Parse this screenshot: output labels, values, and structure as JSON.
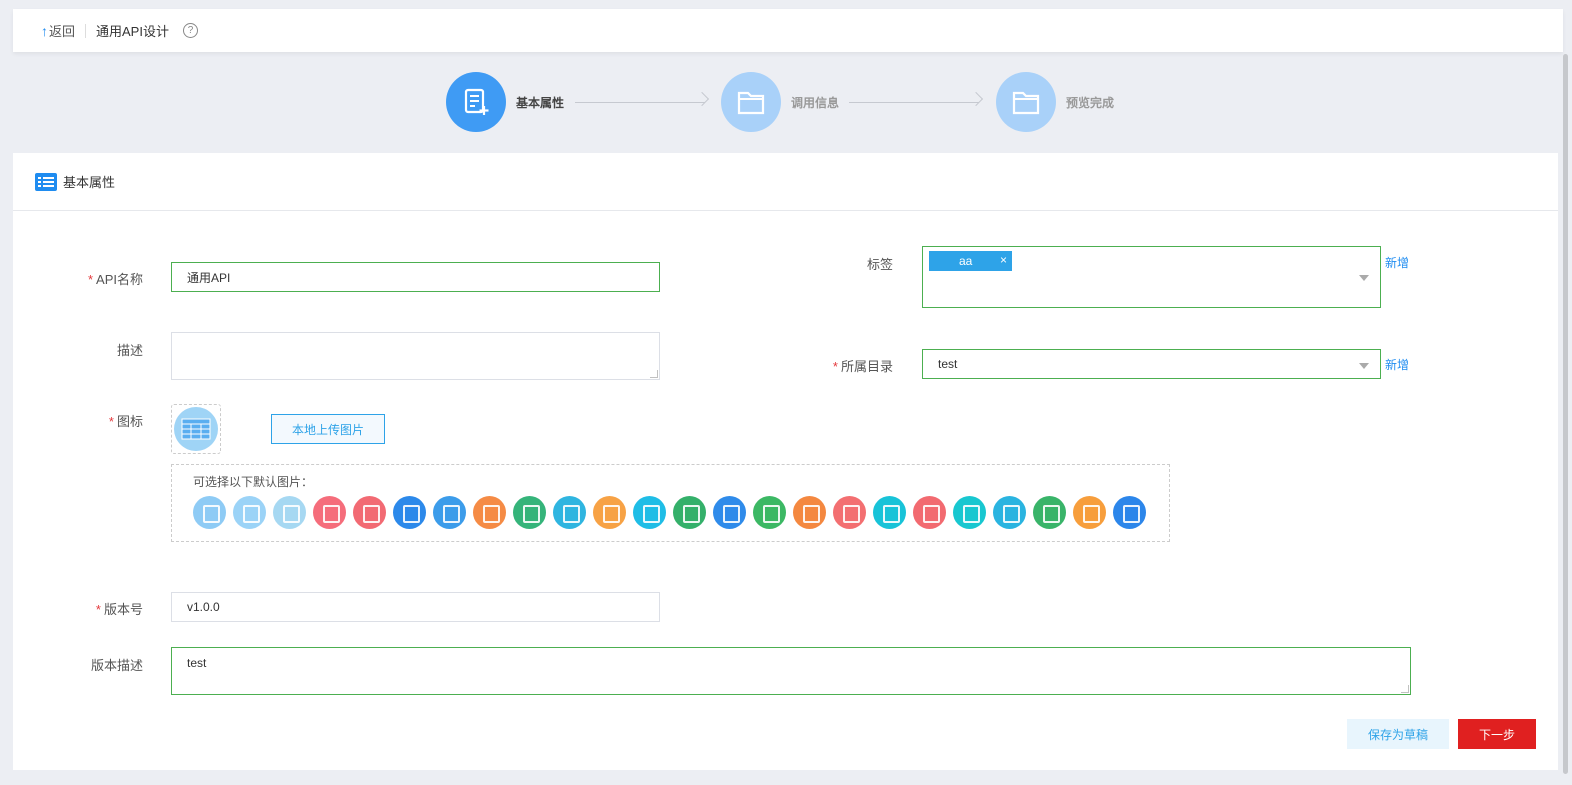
{
  "topbar": {
    "back_label": "返回",
    "title": "通用API设计",
    "help": "?"
  },
  "steps": [
    {
      "label": "基本属性",
      "state": "active"
    },
    {
      "label": "调用信息",
      "state": "inactive"
    },
    {
      "label": "预览完成",
      "state": "inactive"
    }
  ],
  "section": {
    "title": "基本属性"
  },
  "form": {
    "api_name": {
      "label": "API名称",
      "required": "*",
      "value": "通用API"
    },
    "description": {
      "label": "描述",
      "value": ""
    },
    "icon": {
      "label": "图标",
      "required": "*",
      "upload_label": "本地上传图片",
      "default_title": "可选择以下默认图片："
    },
    "version": {
      "label": "版本号",
      "required": "*",
      "value": "v1.0.0"
    },
    "version_desc": {
      "label": "版本描述",
      "value": "test"
    },
    "tags": {
      "label": "标签",
      "tag": "aa",
      "remove": "×",
      "add_label": "新增"
    },
    "directory": {
      "label": "所属目录",
      "required": "*",
      "value": "test",
      "add_label": "新增"
    }
  },
  "default_icon_colors": [
    "#8ecbf5",
    "#9bd3f7",
    "#a6d8f2",
    "#f56d7b",
    "#f26a73",
    "#2c89ea",
    "#3c9cea",
    "#f58b45",
    "#35b47a",
    "#2fb5e0",
    "#f7a245",
    "#1fbde6",
    "#34b06a",
    "#2f8bea",
    "#3cb864",
    "#f48840",
    "#f36f71",
    "#18c3d8",
    "#f26a70",
    "#18c7d0",
    "#2ab4e0",
    "#39b469",
    "#f79e3c",
    "#2c86ea"
  ],
  "actions": {
    "save_draft": "保存为草稿",
    "next": "下一步"
  }
}
